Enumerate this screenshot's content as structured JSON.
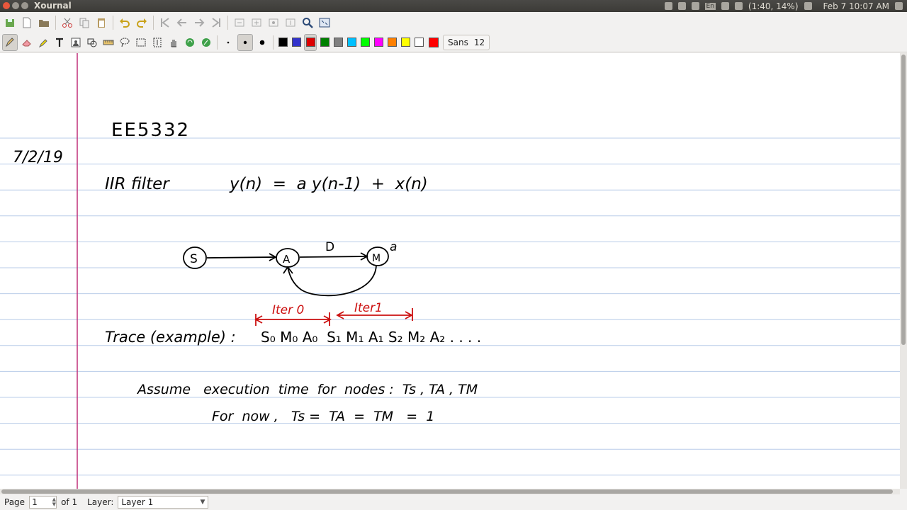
{
  "app": {
    "title": "Xournal"
  },
  "panel": {
    "battery": "(1:40, 14%)",
    "datetime": "Feb 7 10:07 AM",
    "keyboard": "En"
  },
  "toolbar": {
    "font_name": "Sans",
    "font_size": "12",
    "colors": [
      "#000000",
      "#3333cc",
      "#dd0000",
      "#008000",
      "#808080",
      "#00c0ff",
      "#00ff00",
      "#ff00ff",
      "#ff8000",
      "#ffff00",
      "#ffffff"
    ],
    "current_color": "#ff0000"
  },
  "page": {
    "rule_color": "#b8cce8",
    "margin_color": "#c0307a",
    "ink_color": "#000000",
    "red_ink": "#cc1111"
  },
  "notes": {
    "course": "EE5332",
    "date": "7/2/19",
    "filter_label": "IIR filter",
    "equation": "y(n)  =  a y(n-1)  +  x(n)",
    "node_s": "S",
    "node_a": "A",
    "node_m": "M",
    "edge_delay": "D",
    "gain": "a",
    "iter0": "Iter 0",
    "iter1": "Iter1",
    "trace_label": "Trace (example) :",
    "trace_seq": "S₀ M₀ A₀  S₁ M₁ A₁ S₂ M₂ A₂ . . . .",
    "assume": "Assume   execution  time  for  nodes :  Ts , TA , TM",
    "for_now": "For  now ,   Ts =  TA  =  TM   =  1"
  },
  "statusbar": {
    "page_label": "Page",
    "page_value": "1",
    "of_label": "of 1",
    "layer_label": "Layer:",
    "layer_value": "Layer 1"
  }
}
